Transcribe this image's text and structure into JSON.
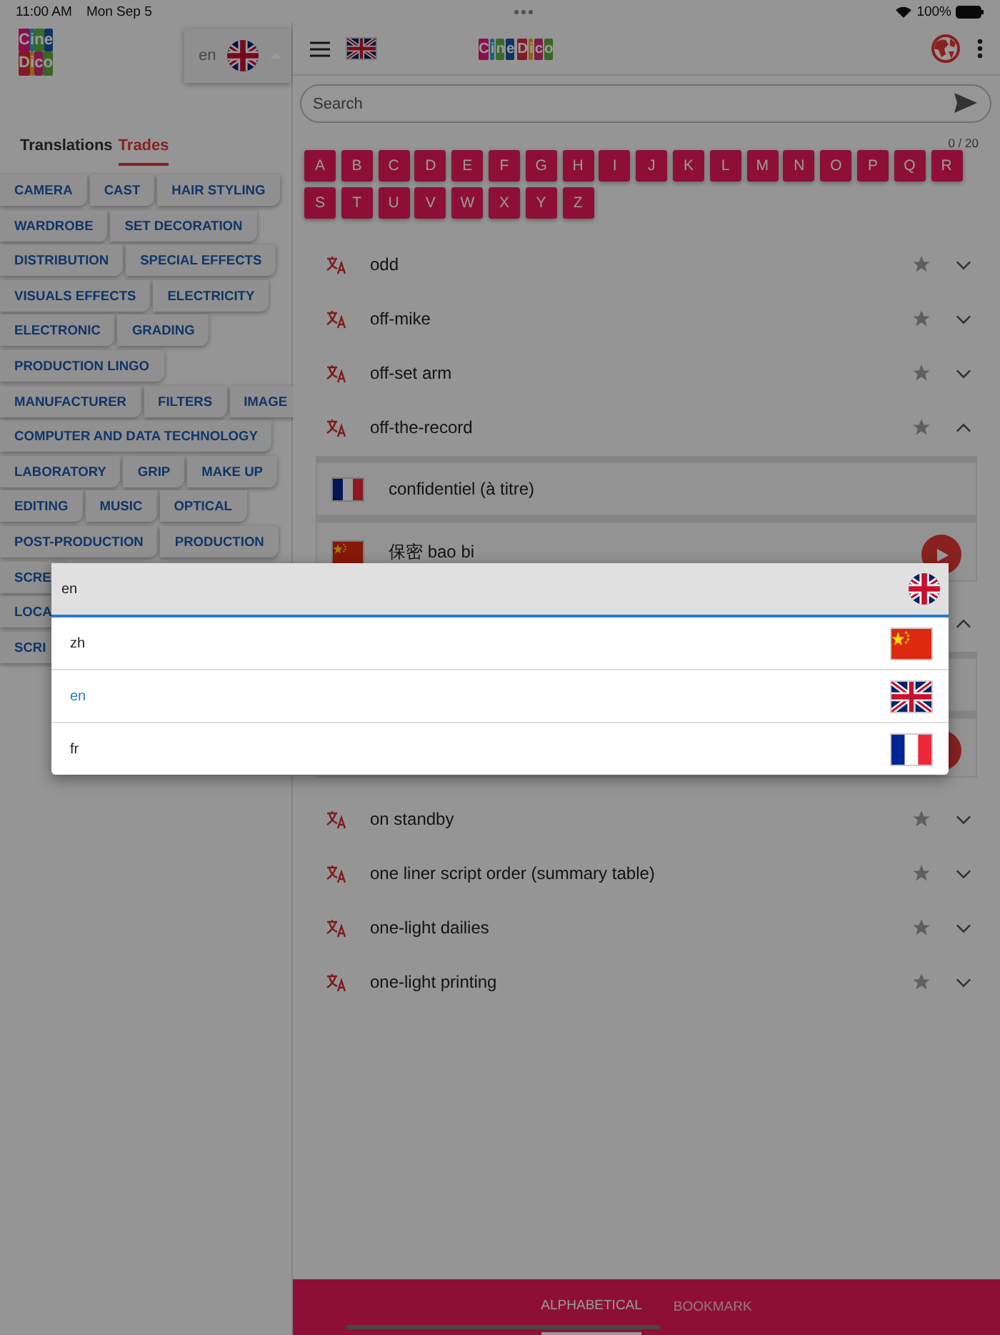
{
  "status_bar": {
    "time": "11:00 AM",
    "date": "Mon Sep 5",
    "battery": "100%"
  },
  "sidebar": {
    "logo": [
      "Cine",
      "Dico"
    ],
    "language": {
      "value": "en",
      "kind": "britain"
    },
    "tabs": [
      {
        "label": "Translations",
        "selected": false
      },
      {
        "label": "Trades",
        "selected": true
      }
    ],
    "trade_rows": [
      [
        "CAMERA",
        "CAST",
        "HAIR STYLING"
      ],
      [
        "WARDROBE",
        "SET DECORATION"
      ],
      [
        "DISTRIBUTION",
        "SPECIAL EFFECTS"
      ],
      [
        "VISUALS EFFECTS",
        "ELECTRICITY"
      ],
      [
        "ELECTRONIC",
        "GRADING"
      ],
      [
        "PRODUCTION LINGO"
      ],
      [
        "MANUFACTURER",
        "FILTERS",
        "IMAGE"
      ],
      [
        "COMPUTER AND DATA TECHNOLOGY"
      ],
      [
        "LABORATORY",
        "GRIP",
        "MAKE UP"
      ],
      [
        "EDITING",
        "MUSIC",
        "OPTICAL"
      ],
      [
        "POST-PRODUCTION",
        "PRODUCTION"
      ],
      [
        "SCRE"
      ],
      [
        "LOCA"
      ],
      [
        "SCRI"
      ]
    ]
  },
  "header": {
    "flag": {
      "kind": "britain"
    },
    "logo": [
      "Cine",
      "Dico"
    ]
  },
  "search": {
    "placeholder": "Search",
    "counter": "0 / 20"
  },
  "letters": [
    "A",
    "B",
    "C",
    "D",
    "E",
    "F",
    "G",
    "H",
    "I",
    "J",
    "K",
    "L",
    "M",
    "N",
    "O",
    "P",
    "Q",
    "R",
    "S",
    "T",
    "U",
    "V",
    "W",
    "X",
    "Y",
    "Z"
  ],
  "entries": [
    {
      "term": "odd",
      "starred": false,
      "expanded": false
    },
    {
      "term": "off-mike",
      "starred": false,
      "expanded": false
    },
    {
      "term": "off-set arm",
      "starred": false,
      "expanded": false
    },
    {
      "term": "off-the-record",
      "starred": false,
      "expanded": true,
      "translations": [
        {
          "kind": "france",
          "text": "confidentiel (à titre)",
          "audio": false
        },
        {
          "kind": "china",
          "text": "保密 bao bi",
          "audio": true
        }
      ]
    },
    {
      "expanded": true,
      "translations": [
        {
          "audio": false
        },
        {
          "audio": true
        }
      ]
    },
    {
      "term": "on standby",
      "starred": false,
      "expanded": false
    },
    {
      "term": "one liner script order (summary table)",
      "starred": false,
      "expanded": false
    },
    {
      "term": "one-light dailies",
      "starred": false,
      "expanded": false
    },
    {
      "term": "one-light printing",
      "starred": false,
      "expanded": false
    }
  ],
  "bottom_tabs": [
    {
      "label": "ALPHABETICAL",
      "selected": true
    },
    {
      "label": "BOOKMARK",
      "selected": false
    }
  ],
  "language_menu": {
    "value": "en",
    "kind": "britain",
    "options": [
      {
        "code": "zh",
        "kind": "china",
        "selected": false
      },
      {
        "code": "en",
        "kind": "britain",
        "selected": true
      },
      {
        "code": "fr",
        "kind": "france",
        "selected": false
      }
    ]
  }
}
